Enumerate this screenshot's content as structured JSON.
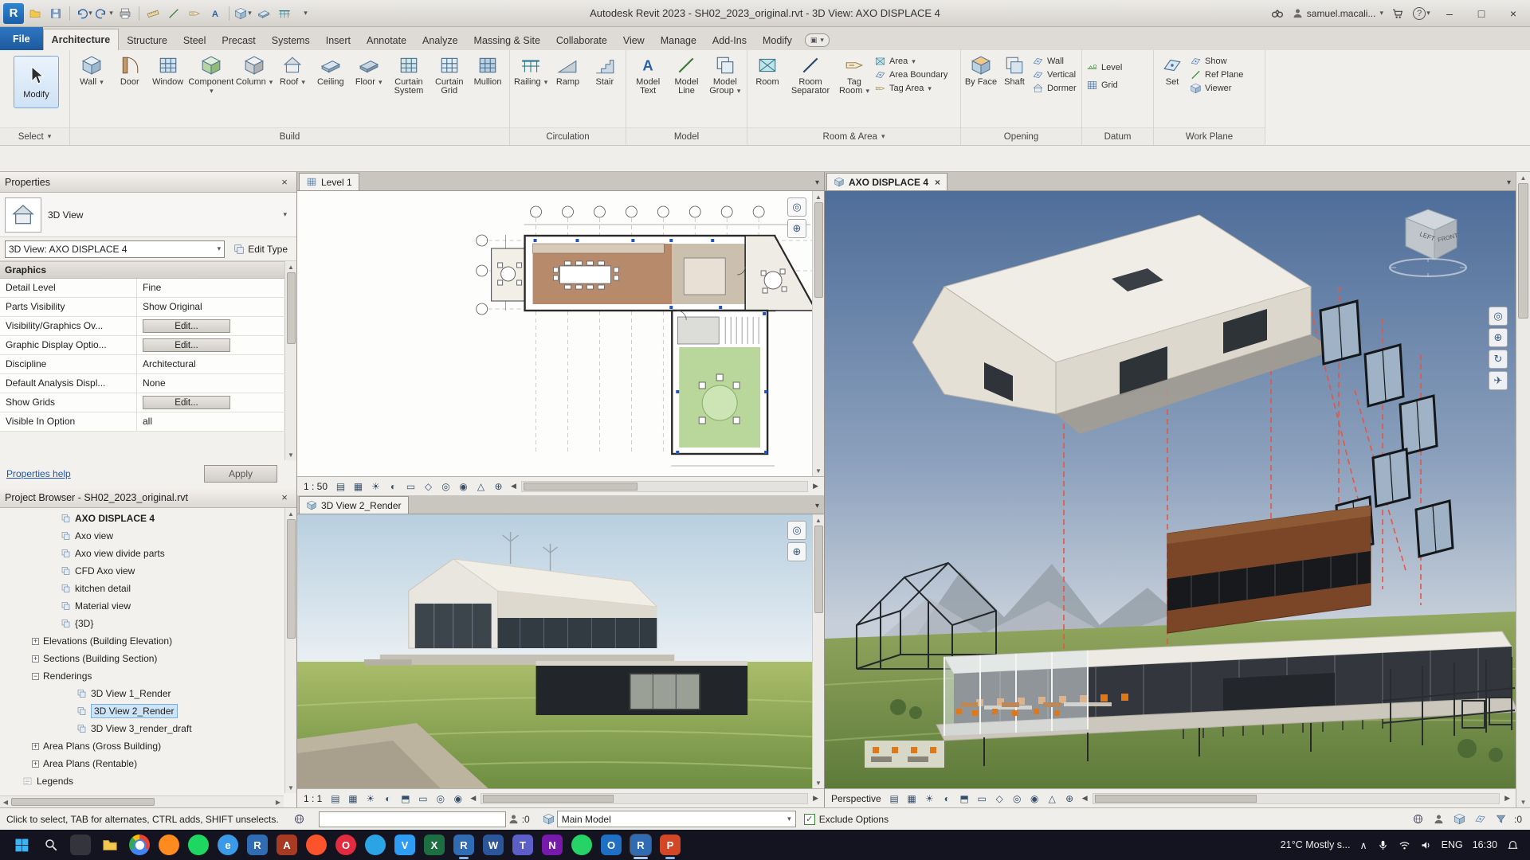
{
  "icons": {
    "dropdown": "▾",
    "close": "×",
    "minimize": "–",
    "maximize": "□",
    "scroll_up": "▲",
    "scroll_down": "▼",
    "scroll_left": "◀",
    "scroll_right": "▶",
    "check": "✓",
    "help": "?",
    "chevron_up": "∧",
    "vc": {
      "detail": "▤",
      "style": "▦",
      "sun": "☀",
      "shadow": "◐",
      "crop": "▭",
      "cropvis": "◇",
      "hide": "◎",
      "reveal": "◉",
      "lock": "⊕",
      "render": "⬒",
      "analysis": "△",
      "wheel": "◎",
      "zoom": "⊕",
      "orbit": "↻",
      "fly": "✈"
    }
  },
  "titlebar": {
    "title": "Autodesk Revit 2023 - SH02_2023_original.rvt - 3D View: AXO DISPLACE 4",
    "user": "samuel.macali..."
  },
  "ribbon_tabs": {
    "items": [
      "File",
      "Architecture",
      "Structure",
      "Steel",
      "Precast",
      "Systems",
      "Insert",
      "Annotate",
      "Analyze",
      "Massing & Site",
      "Collaborate",
      "View",
      "Manage",
      "Add-Ins",
      "Modify"
    ]
  },
  "ribbon": {
    "modify": "Modify",
    "select_panel": "Select",
    "build": {
      "label": "Build",
      "wall": "Wall",
      "door": "Door",
      "window": "Window",
      "component": "Component",
      "column": "Column",
      "roof": "Roof",
      "ceiling": "Ceiling",
      "floor": "Floor",
      "curtain_system": "Curtain System",
      "curtain_grid": "Curtain Grid",
      "mullion": "Mullion"
    },
    "circulation": {
      "label": "Circulation",
      "railing": "Railing",
      "ramp": "Ramp",
      "stair": "Stair"
    },
    "model": {
      "label": "Model",
      "text": "Model Text",
      "line": "Model Line",
      "group": "Model Group"
    },
    "room_area": {
      "label": "Room & Area",
      "room": "Room",
      "separator": "Room Separator",
      "tag_room": "Tag Room",
      "area": "Area",
      "area_boundary": "Area Boundary",
      "tag_area": "Tag Area"
    },
    "opening": {
      "label": "Opening",
      "by_face": "By Face",
      "shaft": "Shaft",
      "wall": "Wall",
      "vertical": "Vertical",
      "dormer": "Dormer"
    },
    "datum": {
      "label": "Datum",
      "level": "Level",
      "grid": "Grid"
    },
    "work_plane": {
      "label": "Work Plane",
      "set": "Set",
      "show": "Show",
      "ref_plane": "Ref Plane",
      "viewer": "Viewer"
    }
  },
  "properties": {
    "title": "Properties",
    "family": "3D View",
    "instance": "3D View: AXO DISPLACE 4",
    "edit_type": "Edit Type",
    "section": "Graphics",
    "rows": [
      {
        "label": "Detail Level",
        "value": "Fine"
      },
      {
        "label": "Parts Visibility",
        "value": "Show Original"
      },
      {
        "label": "Visibility/Graphics Ov...",
        "value": "Edit..."
      },
      {
        "label": "Graphic Display Optio...",
        "value": "Edit..."
      },
      {
        "label": "Discipline",
        "value": "Architectural"
      },
      {
        "label": "Default Analysis Displ...",
        "value": "None"
      },
      {
        "label": "Show Grids",
        "value": "Edit..."
      },
      {
        "label": "Visible In Option",
        "value": "all"
      }
    ],
    "help": "Properties help",
    "apply": "Apply"
  },
  "browser": {
    "title": "Project Browser - SH02_2023_original.rvt",
    "items": [
      {
        "label": "AXO DISPLACE 4"
      },
      {
        "label": "Axo view"
      },
      {
        "label": "Axo view divide parts"
      },
      {
        "label": "CFD Axo view"
      },
      {
        "label": "kitchen detail"
      },
      {
        "label": "Material view"
      },
      {
        "label": "{3D}"
      },
      {
        "label": "Elevations (Building Elevation)",
        "expand": "+"
      },
      {
        "label": "Sections (Building Section)",
        "expand": "+"
      },
      {
        "label": "Renderings",
        "expand": "−"
      },
      {
        "label": "3D View 1_Render"
      },
      {
        "label": "3D View 2_Render"
      },
      {
        "label": "3D View 3_render_draft"
      },
      {
        "label": "Area Plans (Gross Building)",
        "expand": "+"
      },
      {
        "label": "Area Plans (Rentable)",
        "expand": "+"
      },
      {
        "label": "Legends"
      }
    ]
  },
  "plan_view": {
    "tab": "Level 1",
    "scale": "1 : 50"
  },
  "render_view": {
    "tab": "3D View 2_Render",
    "scale": "1 : 1"
  },
  "axo_view": {
    "tab": "AXO DISPLACE 4",
    "mode": "Perspective",
    "cube_left": "LEFT",
    "cube_front": "FRONT"
  },
  "statusbar": {
    "hint": "Click to select, TAB for alternates, CTRL adds, SHIFT unselects.",
    "editable_count": ":0",
    "design_option": "Main Model",
    "exclude_options": "Exclude Options",
    "filter_count": ":0"
  },
  "taskbar": {
    "weather": "21°C  Mostly s...",
    "lang": "ENG",
    "time": "16:30",
    "apps": [
      {
        "name": "start",
        "letter": ""
      },
      {
        "name": "search",
        "letter": ""
      },
      {
        "name": "task-view",
        "color": "#34343c",
        "letter": ""
      },
      {
        "name": "file-explorer",
        "letter": ""
      },
      {
        "name": "chrome",
        "letter": ""
      },
      {
        "name": "firefox",
        "color": "#ff8a1e",
        "letter": ""
      },
      {
        "name": "spotify",
        "color": "#1ed760",
        "letter": ""
      },
      {
        "name": "edge",
        "color": "#3b9ae8",
        "letter": "e"
      },
      {
        "name": "revit",
        "color": "#2f6cb3",
        "letter": "R"
      },
      {
        "name": "autocad",
        "color": "#a63a22",
        "letter": "A"
      },
      {
        "name": "brave",
        "color": "#fb542b",
        "letter": ""
      },
      {
        "name": "opera",
        "color": "#e22b3e",
        "letter": "O"
      },
      {
        "name": "telegram",
        "color": "#2aa4e4",
        "letter": ""
      },
      {
        "name": "vscode",
        "color": "#2f9cf4",
        "letter": "V"
      },
      {
        "name": "excel",
        "color": "#1d6f42",
        "letter": "X"
      },
      {
        "name": "revit-2",
        "color": "#2f6cb3",
        "letter": "R"
      },
      {
        "name": "word",
        "color": "#2b579a",
        "letter": "W"
      },
      {
        "name": "teams",
        "color": "#5b5fc7",
        "letter": "T"
      },
      {
        "name": "onenote",
        "color": "#7719aa",
        "letter": "N"
      },
      {
        "name": "whatsapp",
        "color": "#25d366",
        "letter": ""
      },
      {
        "name": "outlook",
        "color": "#1f6fc4",
        "letter": "O"
      },
      {
        "name": "revit-active",
        "color": "#2f6cb3",
        "letter": "R"
      },
      {
        "name": "powerpoint",
        "color": "#d24726",
        "letter": "P"
      }
    ]
  }
}
